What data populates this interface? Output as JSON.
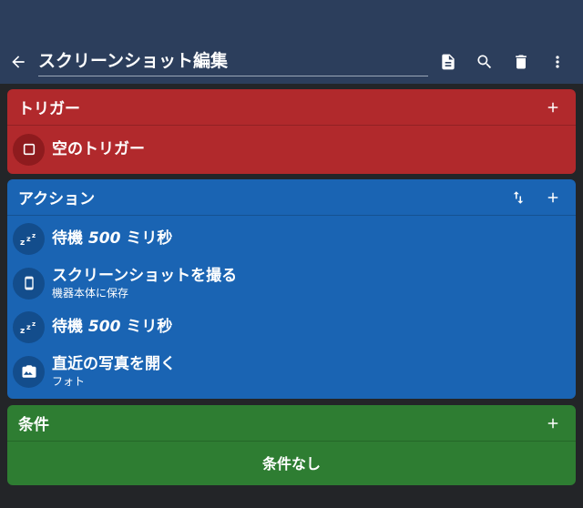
{
  "toolbar": {
    "title": "スクリーンショット編集",
    "icons": [
      "back-arrow-icon",
      "document-icon",
      "search-icon",
      "delete-icon",
      "more-vert-icon"
    ]
  },
  "trigger": {
    "header": "トリガー",
    "items": [
      {
        "label": "空のトリガー",
        "icon": "square-outline-icon"
      }
    ]
  },
  "actions": {
    "header": "アクション",
    "items": [
      {
        "label_prefix": "待機",
        "label_value": "500",
        "label_suffix": "ミリ秒",
        "icon": "sleep-zzz-icon"
      },
      {
        "label": "スクリーンショットを撮る",
        "sublabel": "機器本体に保存",
        "icon": "phone-icon"
      },
      {
        "label_prefix": "待機",
        "label_value": "500",
        "label_suffix": "ミリ秒",
        "icon": "sleep-zzz-icon"
      },
      {
        "label": "直近の写真を開く",
        "sublabel": "フォト",
        "icon": "camera-icon"
      }
    ]
  },
  "conditions": {
    "header": "条件",
    "empty_label": "条件なし"
  },
  "colors": {
    "toolbar": "#2c3e5c",
    "trigger": "#b1292c",
    "action": "#1a64b3",
    "condition": "#2e7d32",
    "background": "#232528"
  }
}
